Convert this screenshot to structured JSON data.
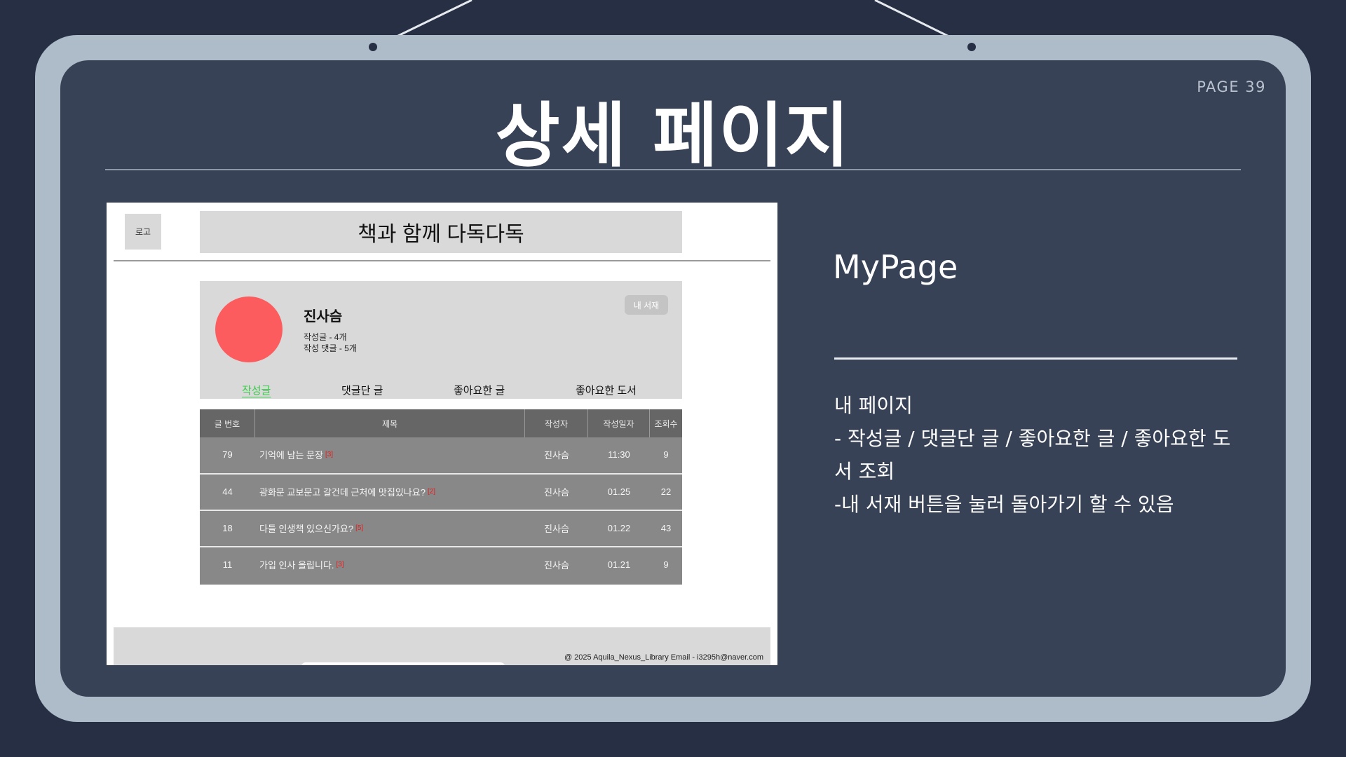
{
  "slide": {
    "page_number": "PAGE 39",
    "title": "상세 페이지"
  },
  "site": {
    "logo": "로고",
    "title": "책과 함께 다독다독"
  },
  "profile": {
    "name": "진사슴",
    "posts_count": "작성글 - 4개",
    "comments_count": "작성 댓글 - 5개",
    "my_library_button": "내 서재",
    "avatar_color": "#fd5c5f"
  },
  "tabs": [
    {
      "label": "작성글",
      "active": true
    },
    {
      "label": "댓글단 글",
      "active": false
    },
    {
      "label": "좋아요한 글",
      "active": false
    },
    {
      "label": "좋아요한 도서",
      "active": false
    }
  ],
  "table": {
    "headers": [
      "글 번호",
      "제목",
      "작성자",
      "작성일자",
      "조회수"
    ],
    "rows": [
      {
        "no": "79",
        "title": "기억에 남는 문장",
        "comments": "[3]",
        "author": "진사슴",
        "date": "11:30",
        "views": "9"
      },
      {
        "no": "44",
        "title": "광화문 교보문고 갈건데 근처에 맛집있나요?",
        "comments": "[2]",
        "author": "진사슴",
        "date": "01.25",
        "views": "22"
      },
      {
        "no": "18",
        "title": "다들 인생책 있으신가요?",
        "comments": "[5]",
        "author": "진사슴",
        "date": "01.22",
        "views": "43"
      },
      {
        "no": "11",
        "title": "가입 인사 올립니다.",
        "comments": "[3]",
        "author": "진사슴",
        "date": "01.21",
        "views": "9"
      }
    ]
  },
  "footer": {
    "text": "@ 2025 Aquila_Nexus_Library   Email - i3295h@naver.com"
  },
  "description": {
    "heading": "MyPage",
    "lines": [
      "내 페이지",
      "- 작성글 / 댓글단 글 / 좋아요한 글 / 좋아요한 도",
      "서 조회",
      "-내 서재 버튼을 눌러 돌아가기 할 수 있음"
    ]
  },
  "colors": {
    "background": "#262f44",
    "frame": "#aebbc9",
    "panel": "#374256",
    "active_tab": "#3ac94a"
  }
}
